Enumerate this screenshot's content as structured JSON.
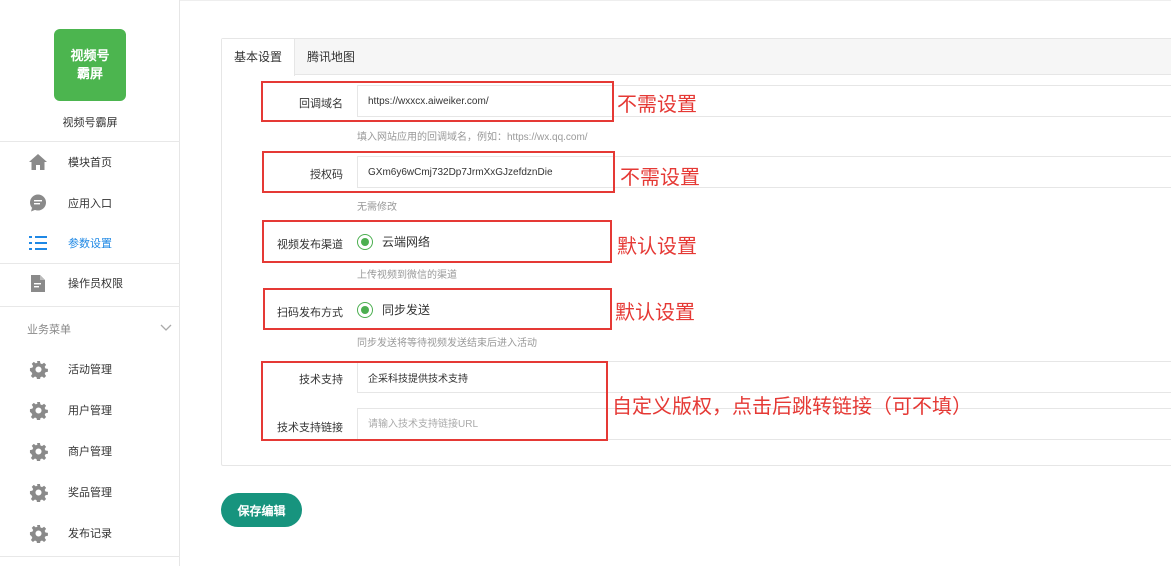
{
  "sidebar": {
    "logo_text_line1": "视频号",
    "logo_text_line2": "霸屏",
    "app_name": "视频号霸屏",
    "items": [
      {
        "label": "模块首页",
        "icon": "home-icon"
      },
      {
        "label": "应用入口",
        "icon": "chat-bubble-icon"
      },
      {
        "label": "参数设置",
        "icon": "list-settings-icon",
        "active": true
      },
      {
        "label": "操作员权限",
        "icon": "document-edit-icon"
      }
    ],
    "section_title": "业务菜单",
    "section_items": [
      {
        "label": "活动管理",
        "icon": "gear-icon"
      },
      {
        "label": "用户管理",
        "icon": "gear-icon"
      },
      {
        "label": "商户管理",
        "icon": "gear-icon"
      },
      {
        "label": "奖品管理",
        "icon": "gear-icon"
      },
      {
        "label": "发布记录",
        "icon": "gear-icon"
      }
    ]
  },
  "tabs": [
    {
      "label": "基本设置",
      "active": true
    },
    {
      "label": "腾讯地图",
      "active": false
    }
  ],
  "form": {
    "callback_domain": {
      "label": "回调域名",
      "value": "https://wxxcx.aiweiker.com/",
      "hint": "填入网站应用的回调域名，例如：https://wx.qq.com/"
    },
    "auth_code": {
      "label": "授权码",
      "value": "GXm6y6wCmj732Dp7JrmXxGJzefdznDie",
      "hint": "无需修改"
    },
    "publish_channel": {
      "label": "视频发布渠道",
      "option": "云端网络",
      "hint": "上传视频到微信的渠道"
    },
    "scan_publish_mode": {
      "label": "扫码发布方式",
      "option": "同步发送",
      "hint": "同步发送将等待视频发送结束后进入活动"
    },
    "tech_support": {
      "label": "技术支持",
      "value": "企采科技提供技术支持"
    },
    "tech_support_link": {
      "label": "技术支持链接",
      "placeholder": "请输入技术支持链接URL"
    }
  },
  "annotations": {
    "a1": "不需设置",
    "a2": "不需设置",
    "a3": "默认设置",
    "a4": "默认设置",
    "a5": "自定义版权，点击后跳转链接（可不填）"
  },
  "save_button": "保存编辑",
  "colors": {
    "brand_green": "#4cb54f",
    "active_blue": "#1e88e5",
    "radio_green": "#4caf50",
    "save_teal": "#17947e",
    "annotation_red": "#e53935"
  }
}
